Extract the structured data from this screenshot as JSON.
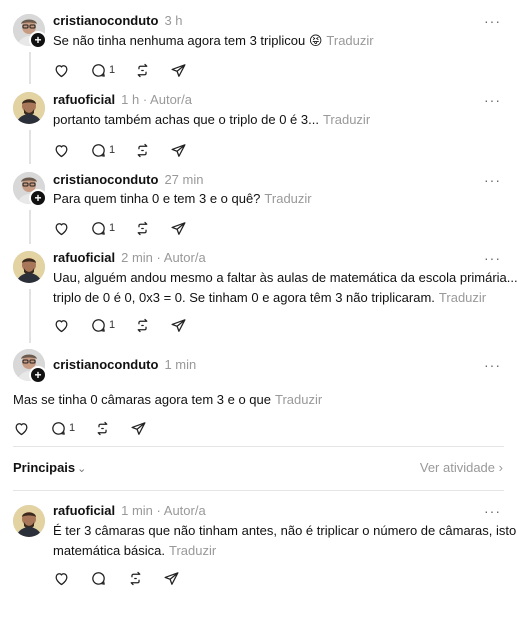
{
  "replies": [
    {
      "username": "cristianoconduto",
      "time": "3 h",
      "author_tag": "",
      "text": "Se não tinha nenhuma agora tem 3 triplicou",
      "emoji": "😝",
      "translate": "Traduzir",
      "reply_count": "1",
      "more": "···"
    },
    {
      "username": "rafuoficial",
      "time": "1 h",
      "author_tag": "· Autor/a",
      "text": "portanto também achas que o triplo de 0 é 3...",
      "translate": "Traduzir",
      "reply_count": "1",
      "more": "···"
    },
    {
      "username": "cristianoconduto",
      "time": "27 min",
      "author_tag": "",
      "text": "Para quem tinha 0 e tem 3 e o quê?",
      "translate": "Traduzir",
      "reply_count": "1",
      "more": "···"
    },
    {
      "username": "rafuoficial",
      "time": "2 min",
      "author_tag": "· Autor/a",
      "text_line1": "Uau, alguém andou mesmo a faltar às aulas de matemática da escola primária... O",
      "text_line2": "triplo de 0 é 0, 0x3 = 0. Se tinham 0 e agora têm 3 não triplicaram.",
      "translate": "Traduzir",
      "reply_count": "1",
      "more": "···"
    },
    {
      "username": "cristianoconduto",
      "time": "1 min",
      "author_tag": "",
      "text": "Mas se tinha 0 câmaras agora tem 3 e o que",
      "translate": "Traduzir",
      "reply_count": "1",
      "more": "···"
    }
  ],
  "sort": {
    "label": "Principais",
    "activity": "Ver atividade",
    "activity_arrow": "›",
    "chevron": "⌄"
  },
  "bottom_post": {
    "username": "rafuoficial",
    "time": "1 min",
    "author_tag": "· Autor/a",
    "text_line1": "É ter 3 câmaras que não tinham antes, não é triplicar o número de câmaras, isto é",
    "text_line2": "matemática básica.",
    "translate": "Traduzir",
    "more": "···"
  },
  "icons": [
    "heart-icon",
    "comment-icon",
    "repost-icon",
    "send-icon",
    "more-icon",
    "plus-icon"
  ],
  "colors": {
    "muted": "#999999",
    "text": "#111111",
    "divider": "#e5e5e5"
  }
}
